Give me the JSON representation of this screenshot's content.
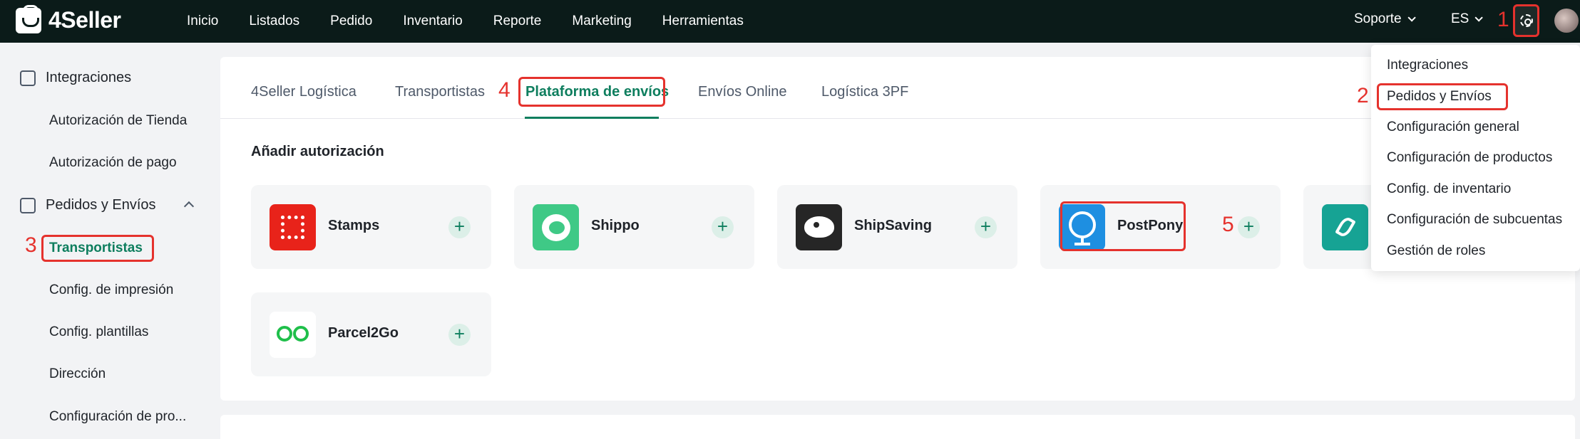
{
  "brand": {
    "name": "4Seller"
  },
  "nav": {
    "items": [
      "Inicio",
      "Listados",
      "Pedido",
      "Inventario",
      "Reporte",
      "Marketing",
      "Herramientas"
    ],
    "support": "Soporte",
    "language": "ES"
  },
  "annotations": [
    "1",
    "2",
    "3",
    "4",
    "5"
  ],
  "settings_menu": {
    "items": [
      "Integraciones",
      "Pedidos y Envíos",
      "Configuración general",
      "Configuración de productos",
      "Config. de inventario",
      "Configuración de subcuentas",
      "Gestión de roles"
    ]
  },
  "sidebar": {
    "group1": "Integraciones",
    "group1_items": [
      "Autorización de Tienda",
      "Autorización de pago"
    ],
    "group2": "Pedidos y Envíos",
    "group2_items": [
      "Transportistas",
      "Config. de impresión",
      "Config. plantillas",
      "Dirección",
      "Configuración de pro..."
    ]
  },
  "tabs": [
    "4Seller Logística",
    "Transportistas",
    "Plataforma de envíos",
    "Envíos Online",
    "Logística 3PF"
  ],
  "section_title": "Añadir autorización",
  "carriers": [
    {
      "name": "Stamps",
      "color": "#e8231a",
      "icon": "stamps-logo"
    },
    {
      "name": "Shippo",
      "color": "#3fc986",
      "icon": "shippo-logo"
    },
    {
      "name": "ShipSaving",
      "color": "#262626",
      "icon": "shipsaving-logo"
    },
    {
      "name": "PostPony",
      "color": "#1e8fe1",
      "icon": "postpony-logo"
    },
    {
      "name": "",
      "color": "#16a394",
      "icon": "carrier-logo"
    },
    {
      "name": "Parcel2Go",
      "color": "#ffffff",
      "icon": "parcel2go-logo"
    }
  ],
  "colors": {
    "accent": "#0e7e5e",
    "annotation": "#e5322d",
    "topbar": "#0b1b19"
  }
}
